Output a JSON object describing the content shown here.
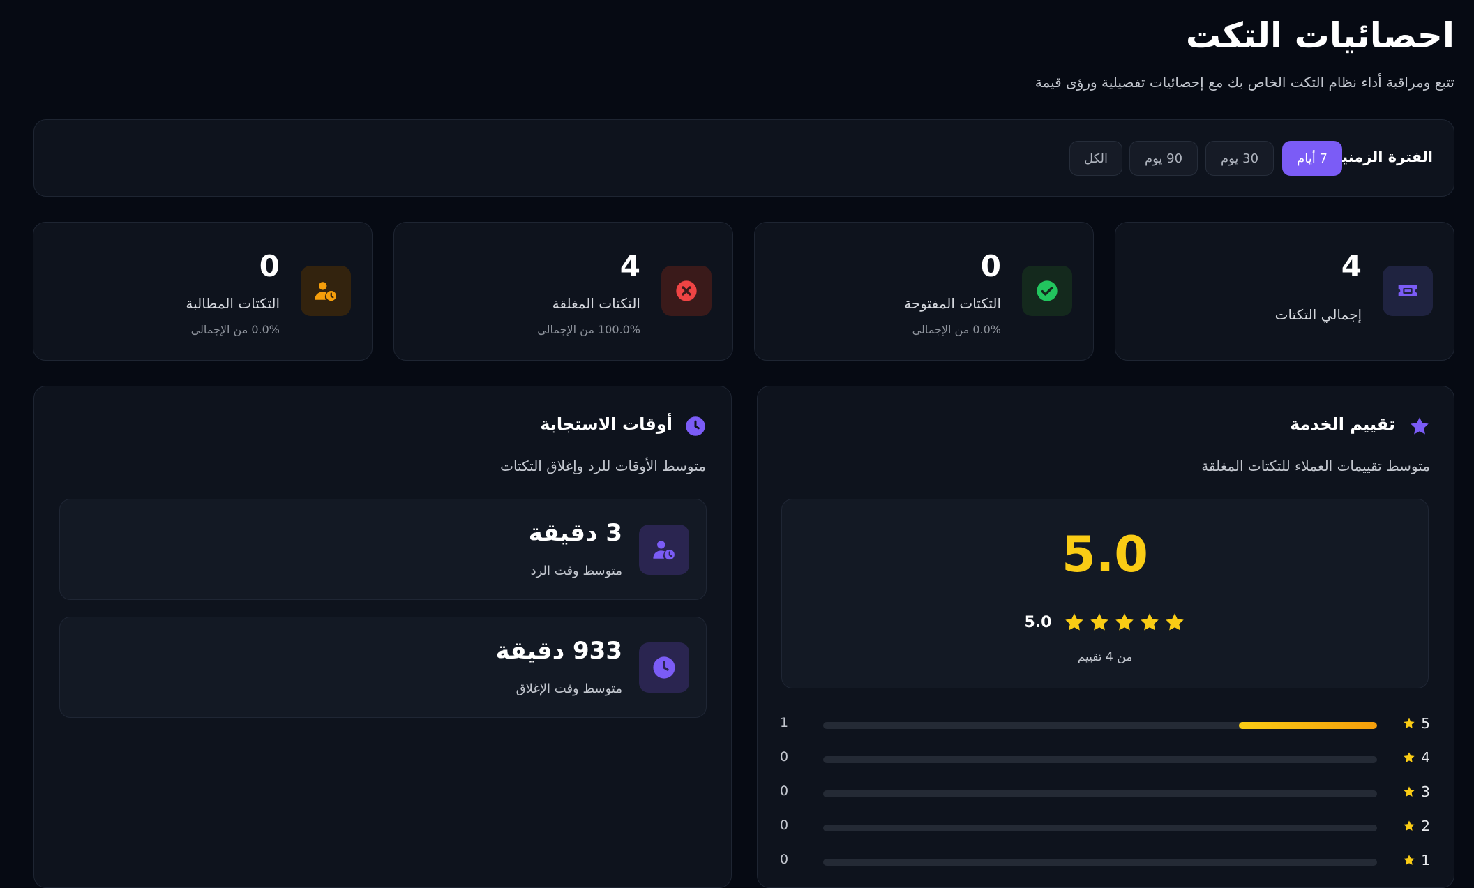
{
  "header": {
    "title": "احصائيات التكت",
    "subtitle": "تتبع ومراقبة أداء نظام التكت الخاص بك مع إحصائيات تفصيلية ورؤى قيمة"
  },
  "period": {
    "label": "الفترة الزمنية:",
    "options": [
      "7 أيام",
      "30 يوم",
      "90 يوم",
      "الكل"
    ],
    "selected": "7 أيام"
  },
  "stats": [
    {
      "value": "4",
      "label": "إجمالي التكتات",
      "icon": "ticket-icon",
      "color": "#7b5cf6"
    },
    {
      "value": "0",
      "label": "التكتات المفتوحة",
      "sub": "0.0% من الإجمالي",
      "icon": "check-circle-icon",
      "color": "#22c55e"
    },
    {
      "value": "4",
      "label": "التكتات المغلقة",
      "sub": "100.0% من الإجمالي",
      "icon": "x-circle-icon",
      "color": "#ef4444"
    },
    {
      "value": "0",
      "label": "التكتات المطالبة",
      "sub": "0.0% من الإجمالي",
      "icon": "user-clock-icon",
      "color": "#f59e0b"
    }
  ],
  "rating": {
    "title": "تقييم الخدمة",
    "description": "متوسط تقييمات العملاء للتكتات المغلقة",
    "average": "5.0",
    "average_small": "5.0",
    "stars": 5,
    "count_text": "من 4 تقييم",
    "distribution": [
      {
        "stars": "5",
        "count": "1",
        "fraction": 0.25
      },
      {
        "stars": "4",
        "count": "0",
        "fraction": 0
      },
      {
        "stars": "3",
        "count": "0",
        "fraction": 0
      },
      {
        "stars": "2",
        "count": "0",
        "fraction": 0
      },
      {
        "stars": "1",
        "count": "0",
        "fraction": 0
      }
    ],
    "accent": "#facc15"
  },
  "response_times": {
    "title": "أوقات الاستجابة",
    "description": "متوسط الأوقات للرد وإغلاق التكتات",
    "items": [
      {
        "value": "3 دقيقة",
        "label": "متوسط وقت الرد",
        "icon": "user-clock-icon"
      },
      {
        "value": "933 دقيقة",
        "label": "متوسط وقت الإغلاق",
        "icon": "clock-icon"
      }
    ],
    "accent": "#7b5cf6"
  }
}
